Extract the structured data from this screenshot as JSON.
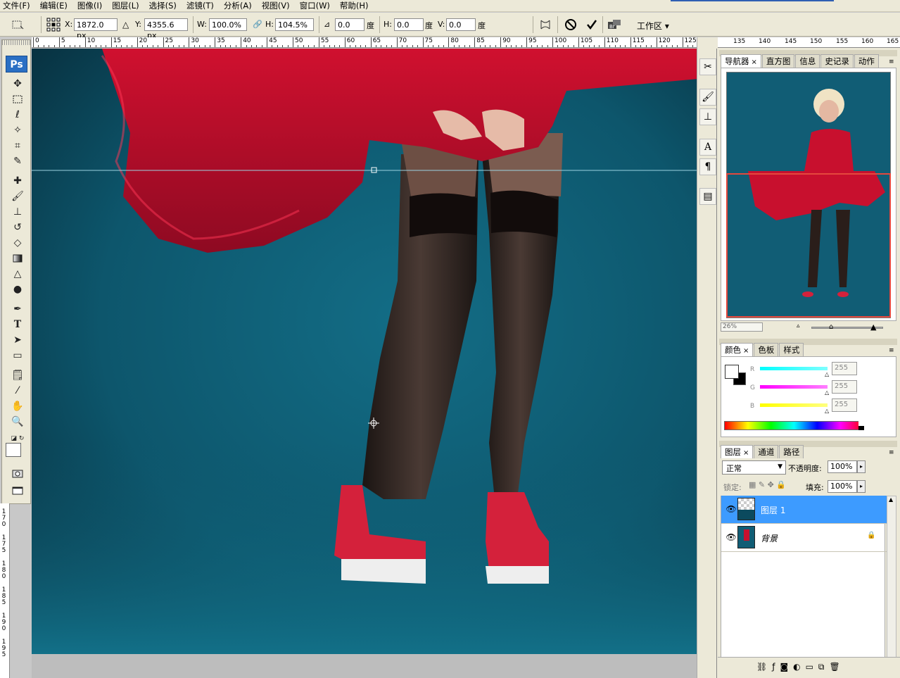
{
  "menu": [
    "文件(F)",
    "编辑(E)",
    "图像(I)",
    "图层(L)",
    "选择(S)",
    "滤镜(T)",
    "分析(A)",
    "视图(V)",
    "窗口(W)",
    "帮助(H)"
  ],
  "options": {
    "x_label": "X:",
    "x_value": "1872.0 px",
    "y_label": "Y:",
    "y_value": "4355.6 px",
    "w_label": "W:",
    "w_value": "100.0%",
    "h_label": "H:",
    "h_value": "104.5%",
    "rot_value": "0.0",
    "rot_unit": "度",
    "hskew_label": "H:",
    "hskew_value": "0.0",
    "hskew_unit": "度",
    "vskew_label": "V:",
    "vskew_value": "0.0",
    "vskew_unit": "度",
    "workspace": "工作区"
  },
  "tools": {
    "ps_logo": "Ps",
    "type_tool": "T"
  },
  "ruler_top": [
    "0",
    "5",
    "10",
    "15",
    "20",
    "25",
    "30",
    "35",
    "40",
    "45",
    "50",
    "55",
    "60",
    "65",
    "70",
    "75",
    "80",
    "85",
    "90",
    "95",
    "100",
    "105",
    "110",
    "115",
    "120",
    "125"
  ],
  "ruler_right": [
    "135",
    "140",
    "145",
    "150",
    "155",
    "160",
    "165"
  ],
  "ruler_left": [
    "170",
    "175",
    "180",
    "185",
    "190",
    "195"
  ],
  "navigator": {
    "tabs": [
      "导航器",
      "直方图",
      "信息",
      "史记录",
      "动作"
    ],
    "zoom": "26%"
  },
  "color_panel": {
    "tabs": [
      "颜色",
      "色板",
      "样式"
    ],
    "channels": [
      {
        "label": "R",
        "value": "255",
        "color": "#00e6e6"
      },
      {
        "label": "G",
        "value": "255",
        "color": "#e600e6"
      },
      {
        "label": "B",
        "value": "255",
        "color": "#e6e600"
      }
    ]
  },
  "layers_panel": {
    "tabs": [
      "图层",
      "通道",
      "路径"
    ],
    "blend_mode": "正常",
    "opacity_label": "不透明度:",
    "opacity_value": "100%",
    "lock_label": "锁定:",
    "fill_label": "填充:",
    "fill_value": "100%",
    "layers": [
      {
        "name": "图层 1",
        "selected": true
      },
      {
        "name": "背景",
        "selected": false,
        "locked": true
      }
    ]
  },
  "colors": {
    "selection": "#3d9bff",
    "canvas_bg": "#0b4a5e",
    "dress": "#c8102e"
  }
}
